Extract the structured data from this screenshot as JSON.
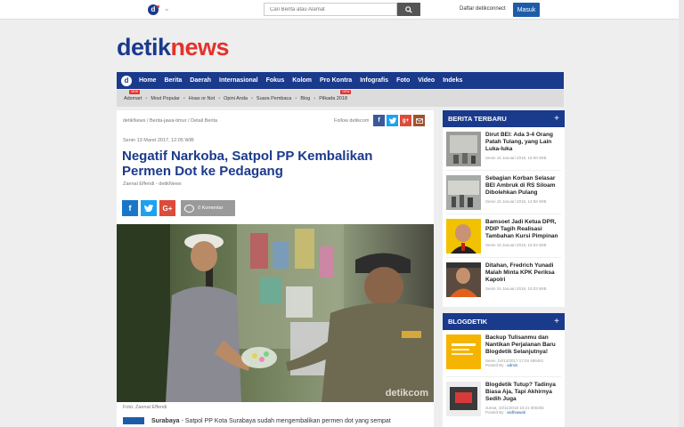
{
  "topbar": {
    "search_placeholder": "Cari Berita atau Alamat",
    "daftar_label": "Daftar detikconnect",
    "masuk_label": "Masuk",
    "logo_letter": "d"
  },
  "brand": {
    "part1": "detik",
    "part2": "news"
  },
  "main_nav": [
    "Home",
    "Berita",
    "Daerah",
    "Internasional",
    "Fokus",
    "Kolom",
    "Pro Kontra",
    "Infografis",
    "Foto",
    "Video",
    "Indeks"
  ],
  "sub_nav": [
    {
      "label": "Adsmart",
      "badge": "NEW"
    },
    {
      "label": "Most Popular"
    },
    {
      "label": "Hoax or Not"
    },
    {
      "label": "Opini Anda"
    },
    {
      "label": "Suara Pembaca"
    },
    {
      "label": "Blog"
    },
    {
      "label": "Pilkada 2018",
      "badge": "NEW"
    }
  ],
  "article": {
    "breadcrumb": "detikNews / Berita-jawa-timur / Detail Berita",
    "follow_label": "Follow detikcom",
    "date": "Senin 13 Maret 2017, 12:05 WIB",
    "title": "Negatif Narkoba, Satpol PP Kembalikan Permen Dot ke Pedagang",
    "author": "Zaenal Effendi - detikNews",
    "komentar": "0 Komentar",
    "photo_watermark": "detikcom",
    "photo_caption": "Foto: Zaenal Effendi",
    "body_lead": "Surabaya",
    "body_text": " - Satpol PP Kota Surabaya sudah mengembalikan permen dot yang sempat"
  },
  "berita_terbaru": {
    "heading": "BERITA TERBARU",
    "items": [
      {
        "title": "Dirut BEI: Ada 3-4 Orang Patah Tulang, yang Lain Luka-luka",
        "date": "Senin 15 Januari 2018, 15:00 WIB"
      },
      {
        "title": "Sebagian Korban Selasar BEI Ambruk di RS Siloam Dibolehkan Pulang",
        "date": "Senin 15 Januari 2018, 14:58 WIB"
      },
      {
        "title": "Bamsoet Jadi Ketua DPR, PDIP Tagih Realisasi Tambahan Kursi Pimpinan",
        "date": "Senin 15 Januari 2018, 15:03 WIB"
      },
      {
        "title": "Ditahan, Fredrich Yunadi Malah Minta KPK Periksa Kapolri",
        "date": "Senin 15 Januari 2018, 15:03 WIB"
      }
    ]
  },
  "blogdetik": {
    "heading": "BLOGDETIK",
    "items": [
      {
        "title": "Backup Tulisanmu dan Nantikan Perjalanan Baru Blogdetik Selanjutnya!",
        "meta": "Senin, 04/12/2017 17:04 486461",
        "by_label": "Posted By :",
        "by": "admin"
      },
      {
        "title": "Blogdetik Tutup? Tadinya Biasa Aja, Tapi Akhirnya Sedih Juga",
        "meta": "Jumat, 10/11/2018 10:21 000265",
        "by_label": "Posted By :",
        "by": "widhiawati"
      }
    ]
  },
  "colors": {
    "brand_blue": "#1a3a8c",
    "brand_red": "#e4322b",
    "facebook": "#3b5998",
    "twitter": "#1da1f2",
    "gplus": "#dd4b39"
  }
}
